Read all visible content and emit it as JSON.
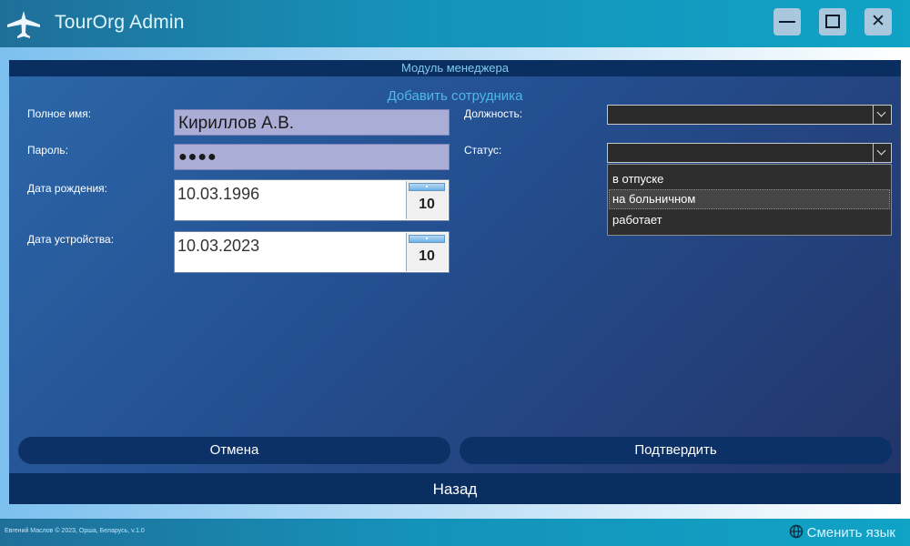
{
  "window": {
    "title": "TourOrg Admin",
    "controls": {
      "minimize": "minimize-icon",
      "maximize": "maximize-icon",
      "close": "✕"
    }
  },
  "module": {
    "header": "Модуль менеджера"
  },
  "form": {
    "title": "Добавить сотрудника",
    "full_name": {
      "label": "Полное имя:",
      "value": "Кириллов А.В."
    },
    "password": {
      "label": "Пароль:",
      "value": "●●●●"
    },
    "birth_date": {
      "label": "Дата рождения:",
      "value": "10.03.1996",
      "calendar_day": "10"
    },
    "hire_date": {
      "label": "Дата устройства:",
      "value": "10.03.2023",
      "calendar_day": "10"
    },
    "position": {
      "label": "Должность:",
      "value": ""
    },
    "status": {
      "label": "Статус:",
      "value": "",
      "options": [
        "в отпуске",
        "на больничном",
        "работает"
      ],
      "highlighted_option": "на больничном"
    },
    "cancel_label": "Отмена",
    "confirm_label": "Подтвердить"
  },
  "back_label": "Назад",
  "footer": {
    "copyright": "Евгений Маслов © 2023, Орша, Беларусь, v.1.0",
    "language_label": "Сменить язык"
  },
  "colors": {
    "accent": "#0b2e61",
    "title_bar": "#1592b9",
    "panel": "#244f90",
    "input_bg": "#aaadd6"
  }
}
